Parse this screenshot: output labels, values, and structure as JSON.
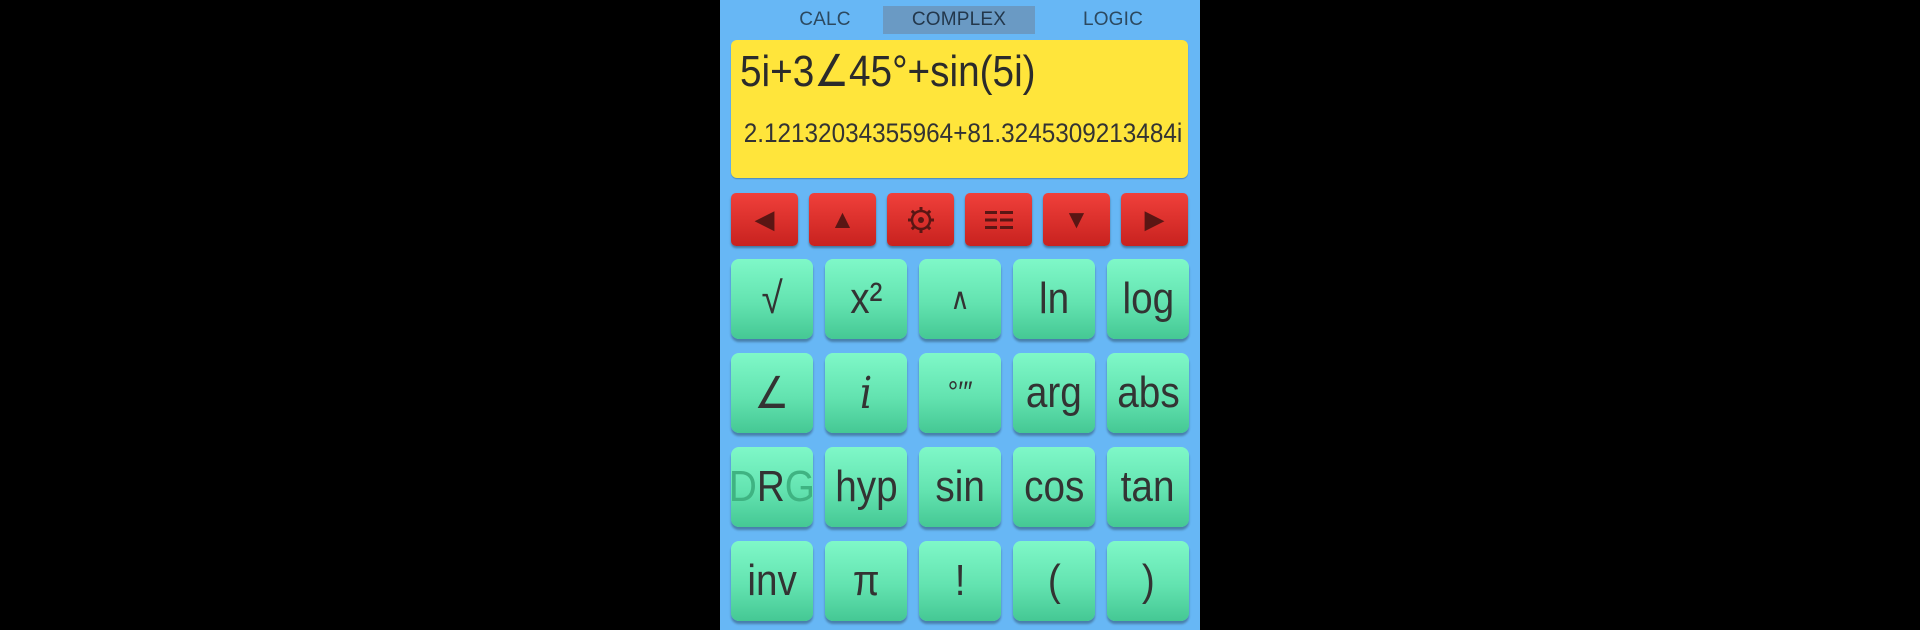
{
  "tabs": [
    {
      "label": "CALC",
      "active": false
    },
    {
      "label": "COMPLEX",
      "active": true
    },
    {
      "label": "LOGIC",
      "active": false
    }
  ],
  "display": {
    "expression": "5i+3∠45°+sin(5i)",
    "result": "2.12132034355964+81.3245309213484i"
  },
  "controls": [
    {
      "name": "left-arrow-icon",
      "glyph": "◀"
    },
    {
      "name": "up-arrow-icon",
      "glyph": "▲"
    },
    {
      "name": "settings-icon",
      "glyph": "⚙"
    },
    {
      "name": "menu-icon",
      "glyph": "☷"
    },
    {
      "name": "down-arrow-icon",
      "glyph": "▼"
    },
    {
      "name": "right-arrow-icon",
      "glyph": "▶"
    }
  ],
  "keys": {
    "row1": [
      "√",
      "x²",
      "∧",
      "ln",
      "log"
    ],
    "row2": [
      "∠",
      "i",
      "°′″",
      "arg",
      "abs"
    ],
    "row3": [
      "DRG",
      "hyp",
      "sin",
      "cos",
      "tan"
    ],
    "row4": [
      "inv",
      "π",
      "!",
      "(",
      ")"
    ]
  },
  "drg": {
    "d": "D",
    "r": "R",
    "g": "G"
  },
  "colors": {
    "background": "#67b7f5",
    "display": "#ffe53b",
    "control_key": "#e3302c",
    "function_key": "#63e3b0",
    "tab_active": "#6a9ac4"
  }
}
